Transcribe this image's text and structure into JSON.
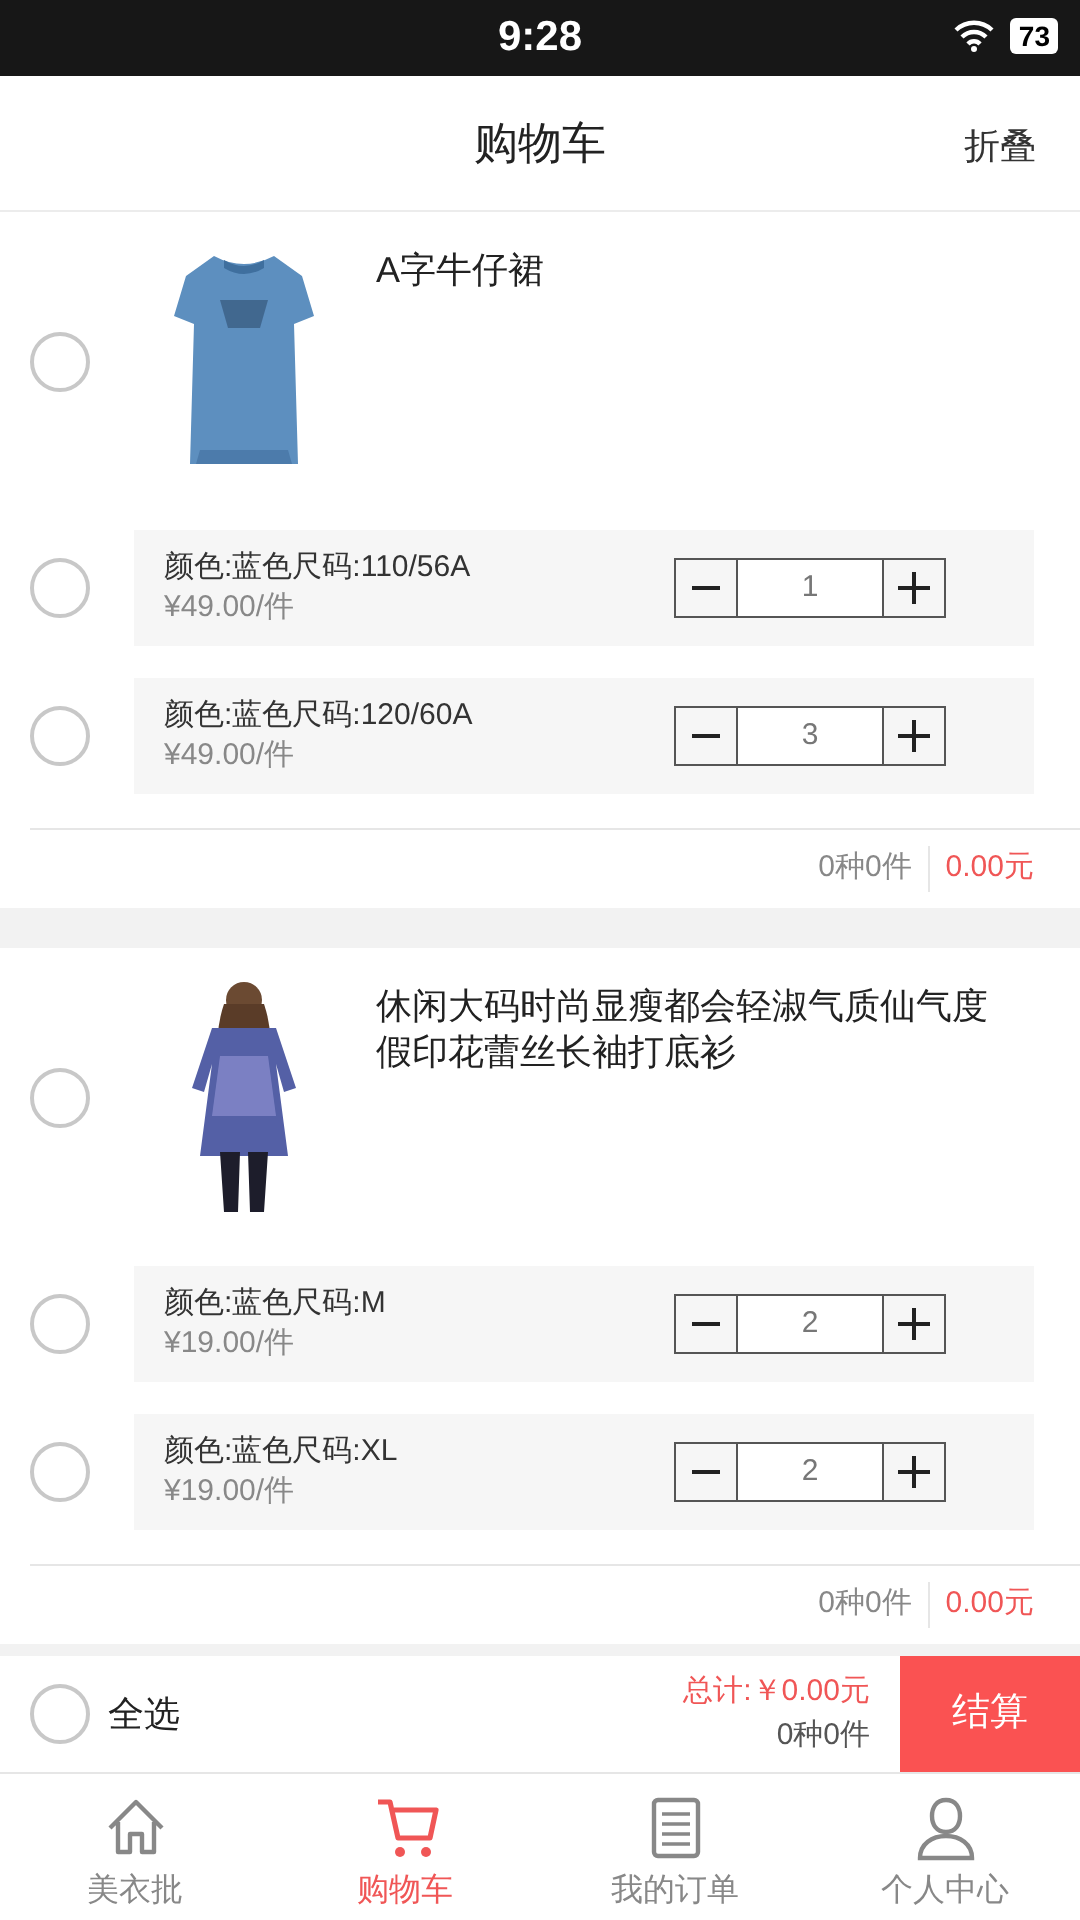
{
  "status_bar": {
    "time": "9:28",
    "battery": "73"
  },
  "header": {
    "title": "购物车",
    "action": "折叠"
  },
  "shops": [
    {
      "selected": false,
      "product": {
        "name": "A字牛仔裙"
      },
      "variants": [
        {
          "spec": "颜色:蓝色尺码:110/56A",
          "price": "¥49.00/件",
          "quantity": "1",
          "selected": false
        },
        {
          "spec": "颜色:蓝色尺码:120/60A",
          "price": "¥49.00/件",
          "quantity": "3",
          "selected": false
        }
      ],
      "subtotal": {
        "count": "0种0件",
        "amount": "0.00元"
      }
    },
    {
      "selected": false,
      "product": {
        "name": "休闲大码时尚显瘦都会轻淑气质仙气度假印花蕾丝长袖打底衫"
      },
      "variants": [
        {
          "spec": "颜色:蓝色尺码:M",
          "price": "¥19.00/件",
          "quantity": "2",
          "selected": false
        },
        {
          "spec": "颜色:蓝色尺码:XL",
          "price": "¥19.00/件",
          "quantity": "2",
          "selected": false
        }
      ],
      "subtotal": {
        "count": "0种0件",
        "amount": "0.00元"
      }
    }
  ],
  "checkout_bar": {
    "select_all": {
      "label": "全选",
      "selected": false
    },
    "total": "总计:￥0.00元",
    "count": "0种0件",
    "button": "结算"
  },
  "tab_bar": [
    {
      "label": "美衣批",
      "selected": false
    },
    {
      "label": "购物车",
      "selected": true
    },
    {
      "label": "我的订单",
      "selected": false
    },
    {
      "label": "个人中心",
      "selected": false
    }
  ]
}
